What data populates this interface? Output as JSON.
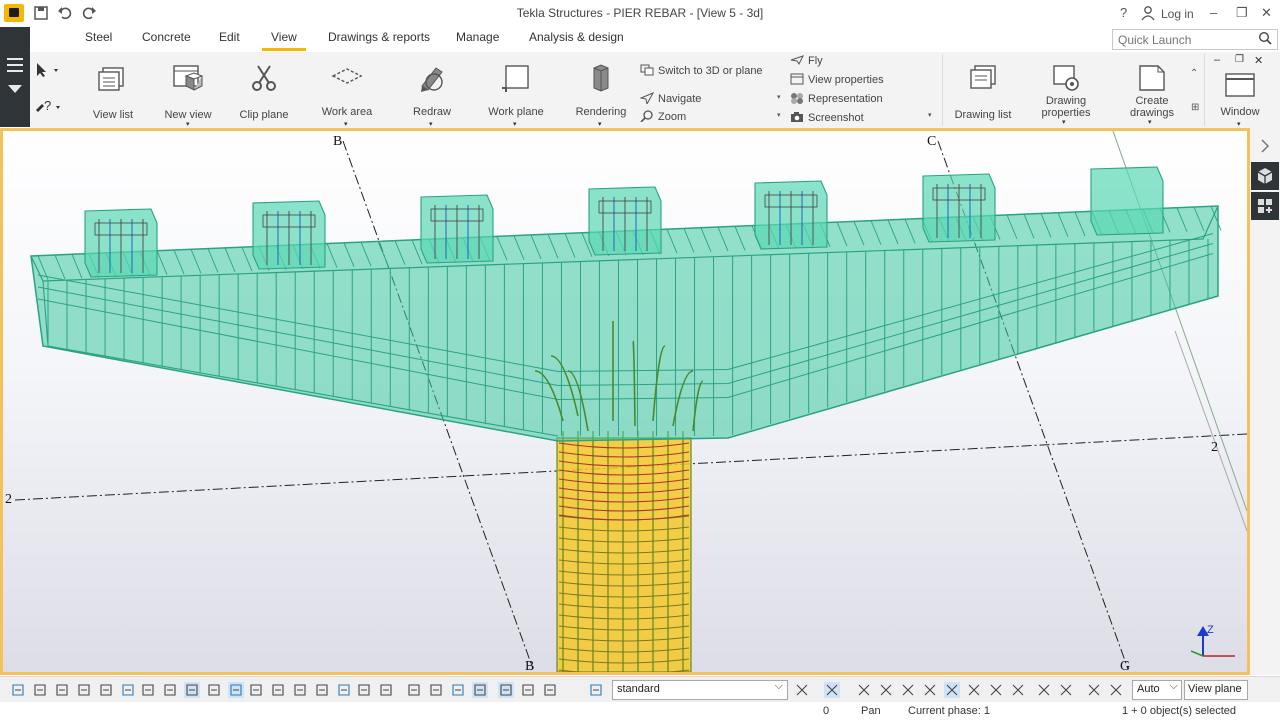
{
  "window": {
    "title": "Tekla Structures - PIER REBAR - [View 5 - 3d]",
    "help_label": "?",
    "login_label": "Log in",
    "minimize": "–",
    "restore": "❐",
    "close": "✕"
  },
  "tabs": [
    "Steel",
    "Concrete",
    "Edit",
    "View",
    "Drawings & reports",
    "Manage",
    "Analysis & design"
  ],
  "active_tab": "View",
  "quick_launch": {
    "placeholder": "Quick Launch"
  },
  "ribbon": {
    "view_list": "View list",
    "new_view": "New view",
    "clip_plane": "Clip plane",
    "work_area": "Work area",
    "redraw": "Redraw",
    "work_plane": "Work plane",
    "rendering": "Rendering",
    "switch_3d": "Switch to 3D or plane",
    "navigate": "Navigate",
    "zoom": "Zoom",
    "fly": "Fly",
    "view_properties": "View properties",
    "representation": "Representation",
    "screenshot": "Screenshot",
    "drawing_list": "Drawing list",
    "drawing_properties": "Drawing properties",
    "create_drawings": "Create drawings",
    "window": "Window"
  },
  "grid_labels": {
    "b_top": "B",
    "c_top": "C",
    "b_bottom": "B",
    "c_bottom": "G",
    "two_left": "2",
    "two_right": "2"
  },
  "axis": {
    "z": "Z"
  },
  "bottom_toolbar": {
    "filter": "standard",
    "snap_mode": "Auto",
    "view_plane": "View plane"
  },
  "status": {
    "value": "0",
    "mode": "Pan",
    "phase": "Current phase: 1",
    "selection": "1 + 0 object(s) selected"
  }
}
